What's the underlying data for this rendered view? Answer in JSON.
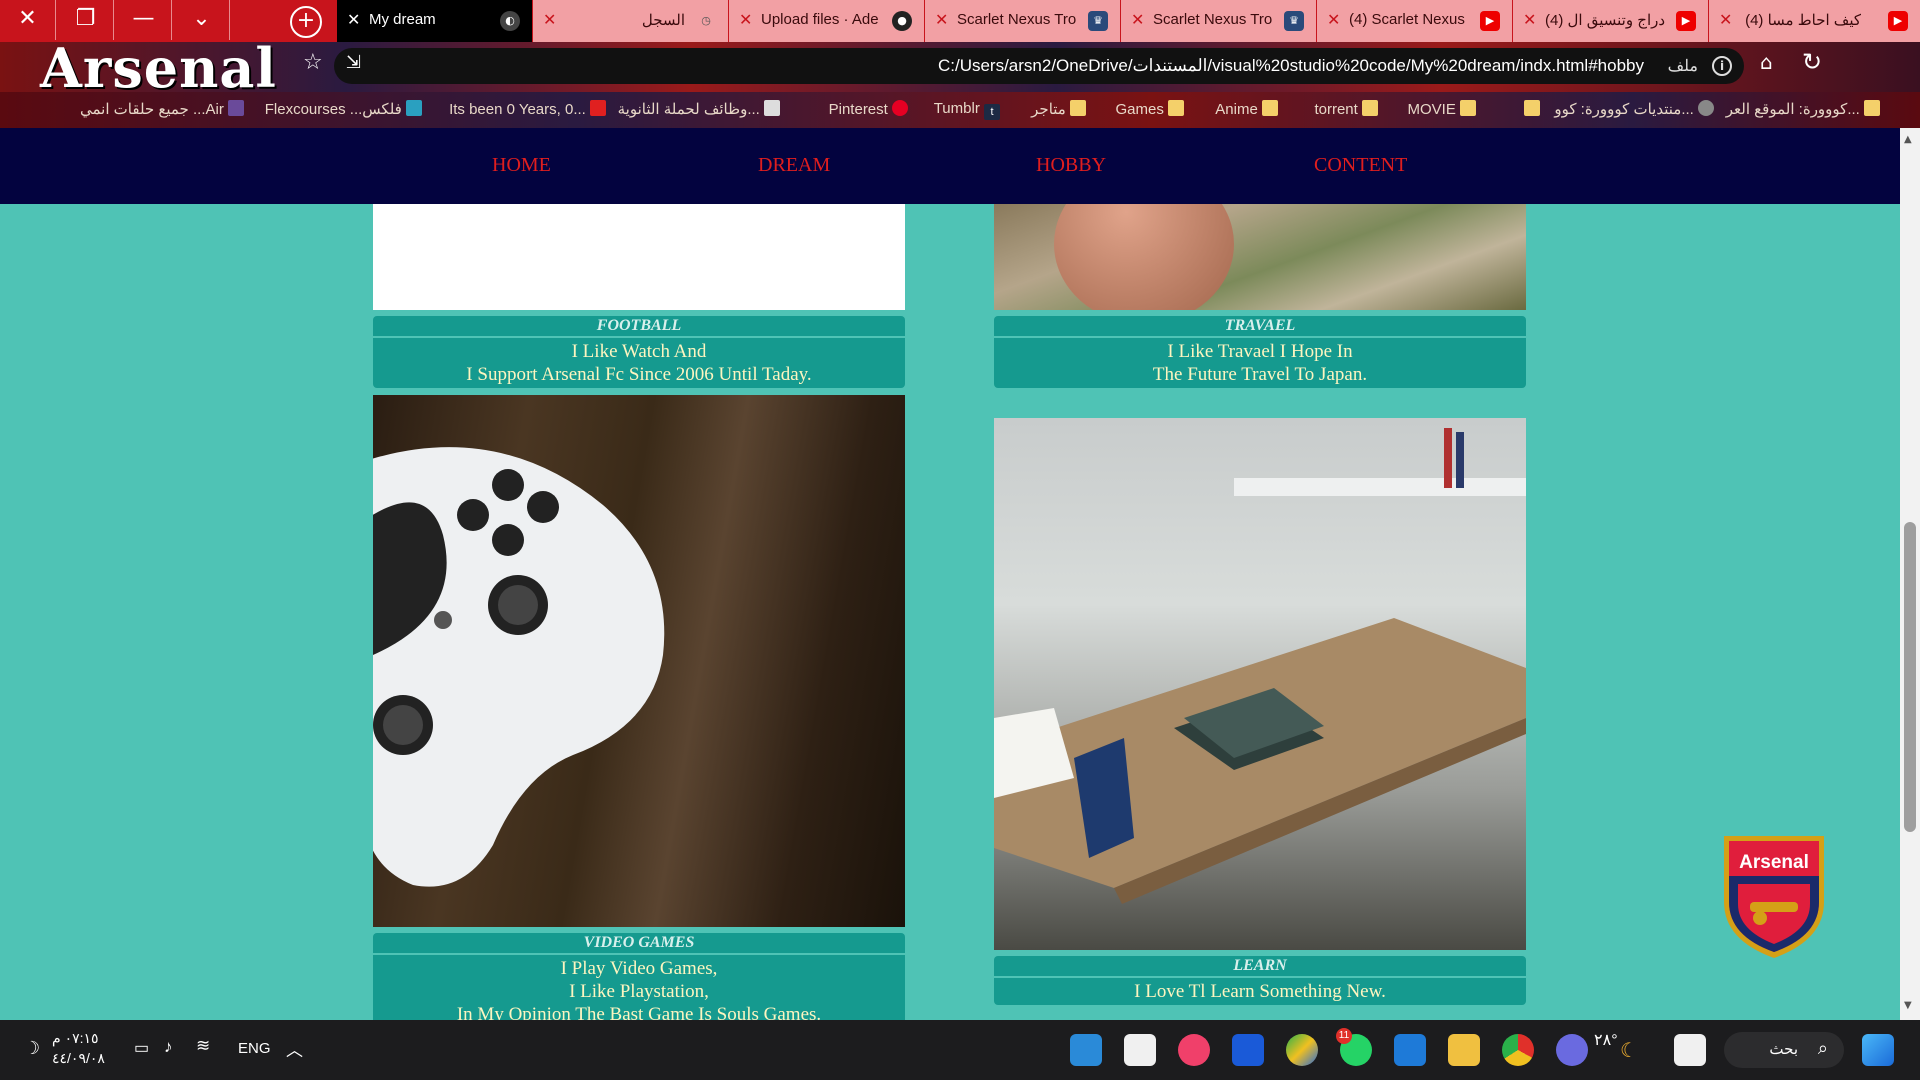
{
  "window": {
    "close_glyph": "✕",
    "restore_glyph": "❐",
    "minimize_glyph": "—",
    "tabsearch_glyph": "⌄"
  },
  "tabs": [
    {
      "title": "My dream",
      "icon": "globe-icon",
      "active": true
    },
    {
      "title": "السجل",
      "icon": "history-icon",
      "active": false
    },
    {
      "title": "Upload files · Ade",
      "icon": "github-icon",
      "active": false
    },
    {
      "title": "Scarlet Nexus Tro",
      "icon": "trophy-icon",
      "active": false
    },
    {
      "title": "Scarlet Nexus Tro",
      "icon": "trophy-icon",
      "active": false
    },
    {
      "title": "(4) Scarlet Nexus",
      "icon": "youtube-icon",
      "active": false
    },
    {
      "title": "(4) إدراج وتنسيق ال",
      "icon": "youtube-icon",
      "active": false
    },
    {
      "title": "(4) كيف احاط مسا",
      "icon": "youtube-icon",
      "active": false
    }
  ],
  "addressbar": {
    "brand": "Arsenal",
    "url": "C:/Users/arsn2/OneDrive/المستندات/visual%20studio%20code/My%20dream/indx.html#hobby",
    "file_label": "ملف"
  },
  "bookmarks": [
    {
      "label": "كووورة: الموقع العر...",
      "icon": "kooora-icon"
    },
    {
      "label": "منتديات كووورة: كوو...",
      "icon": "globe-icon"
    },
    {
      "label": "",
      "icon": "folder-icon"
    },
    {
      "label": "MOVIE",
      "icon": "folder-icon"
    },
    {
      "label": "torrent",
      "icon": "folder-icon"
    },
    {
      "label": "Anime",
      "icon": "folder-icon"
    },
    {
      "label": "Games",
      "icon": "folder-icon"
    },
    {
      "label": "متاجر",
      "icon": "folder-icon"
    },
    {
      "label": "Tumblr",
      "icon": "tumblr-icon"
    },
    {
      "label": "Pinterest",
      "icon": "pinterest-icon"
    },
    {
      "label": "وظائف لحملة الثانوية...",
      "icon": "jobs-icon"
    },
    {
      "label": "Its been 0 Years, 0...",
      "icon": "tracker-icon"
    },
    {
      "label": "Flexcourses ...فلكس",
      "icon": "flex-icon"
    },
    {
      "label": "جميع حلقات انمي ...Air",
      "icon": "anime-icon"
    }
  ],
  "site_nav": [
    "HOME",
    "DREAM",
    "HOBBY",
    "CONTENT"
  ],
  "hobbies": [
    {
      "title": "FOOTBALL",
      "lines": [
        "I Like Watch And",
        "I Support Arsenal Fc Since 2006 Until Taday."
      ]
    },
    {
      "title": "TRAVAEL",
      "lines": [
        "I Like Travael I Hope In",
        "The Future Travel To Japan."
      ]
    },
    {
      "title": "VIDEO GAMES",
      "lines": [
        "I Play Video Games,",
        "I Like Playstation,",
        "In My Opinion The Bast Game Is Souls Games."
      ]
    },
    {
      "title": "LEARN",
      "lines": [
        "I Love Tl Learn Something New."
      ]
    }
  ],
  "crest_text": "Arsenal",
  "taskbar": {
    "time": "٠٧:١٥ م",
    "date": "٤٤/٠٩/٠٨",
    "language": "ENG",
    "weather": "٢٨°",
    "search_label": "بحث",
    "whatsapp_badge": "11"
  },
  "colors": {
    "page_bg": "#4fc3b5",
    "nav_bg": "#03033f",
    "nav_link": "#e01e1e",
    "caption_bg": "#159a8f",
    "caption_text": "#fdf5c0",
    "tab_strip": "#c8141c"
  }
}
